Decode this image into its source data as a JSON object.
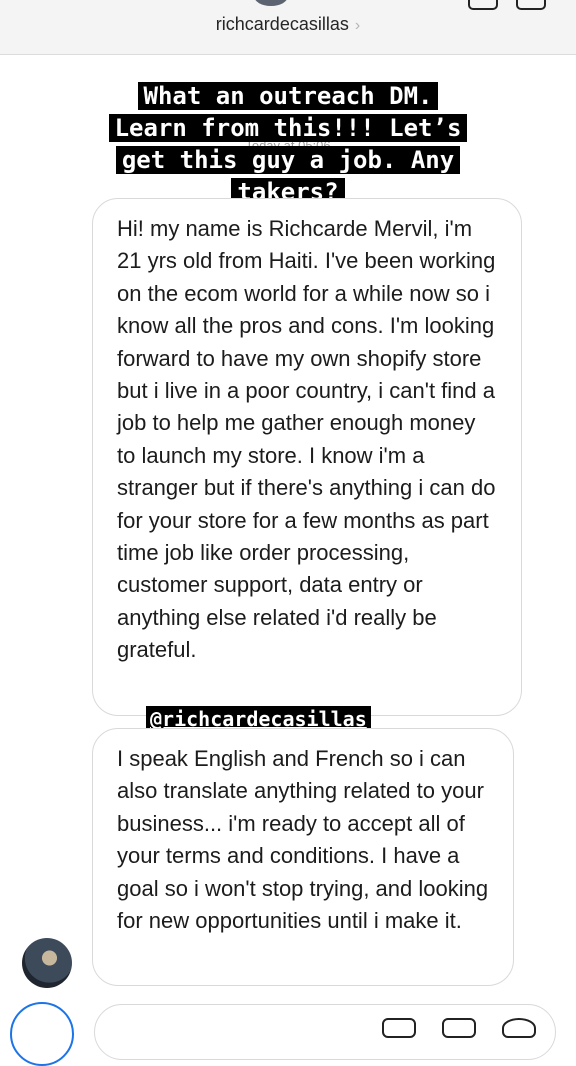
{
  "header": {
    "username": "richcardecasillas",
    "chevron": "›"
  },
  "timestamp": "Today at 05:06",
  "caption": {
    "lines": [
      "What an outreach DM.",
      "Learn from this!!! Let’s",
      "get this guy a job. Any",
      "takers?"
    ]
  },
  "mention": "@richcardecasillas",
  "messages": [
    {
      "text": "Hi! my name is Richcarde Mervil, i'm 21 yrs old from Haiti. I've been working on the ecom world for a while now so i know all the pros and cons. I'm looking forward to have my own shopify store but i live in a poor country, i can't find a job to help me gather enough money to launch my store. I know i'm a stranger but if there's anything i can do for your store for a few months as part time job like order processing, customer support, data entry or anything else related i'd really be grateful."
    },
    {
      "text": "I speak English and French so i can also translate anything related to your business... i'm ready to accept all of your terms and conditions. I have a goal so i won't stop trying, and looking for new opportunities until i make it."
    }
  ],
  "icons": {
    "header_left_avatar": "avatar",
    "header_right_1": "video-icon",
    "header_right_2": "info-icon",
    "compose_camera": "camera-icon",
    "compose_mic": "microphone-icon",
    "compose_gallery": "gallery-icon",
    "compose_sticker": "sticker-icon"
  },
  "colors": {
    "accent_blue": "#1b74e8",
    "bubble_border": "#d9d9d9",
    "caption_bg": "#000000"
  }
}
